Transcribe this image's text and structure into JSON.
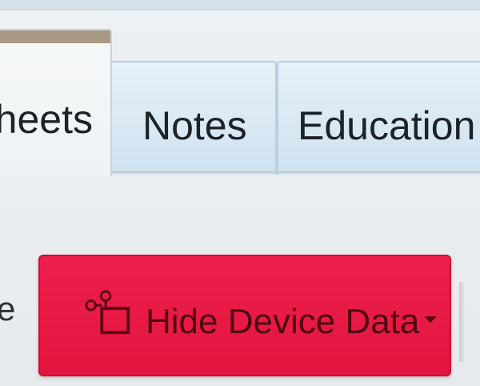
{
  "tabs": [
    {
      "label": "Sheets",
      "visible_label": "heets",
      "selected": true
    },
    {
      "label": "Notes",
      "selected": false
    },
    {
      "label": "Education",
      "visible_label": "Education",
      "selected": false
    }
  ],
  "left_fragment": "e",
  "device_button": {
    "label": "Hide Device Data",
    "icon": "device-icon",
    "background": "#e81f47",
    "text_color": "#4f0612"
  },
  "colors": {
    "tab_fill": "#d8e8f4",
    "tab_border": "#b9cfdf",
    "active_tab_accent": "#a99984"
  }
}
